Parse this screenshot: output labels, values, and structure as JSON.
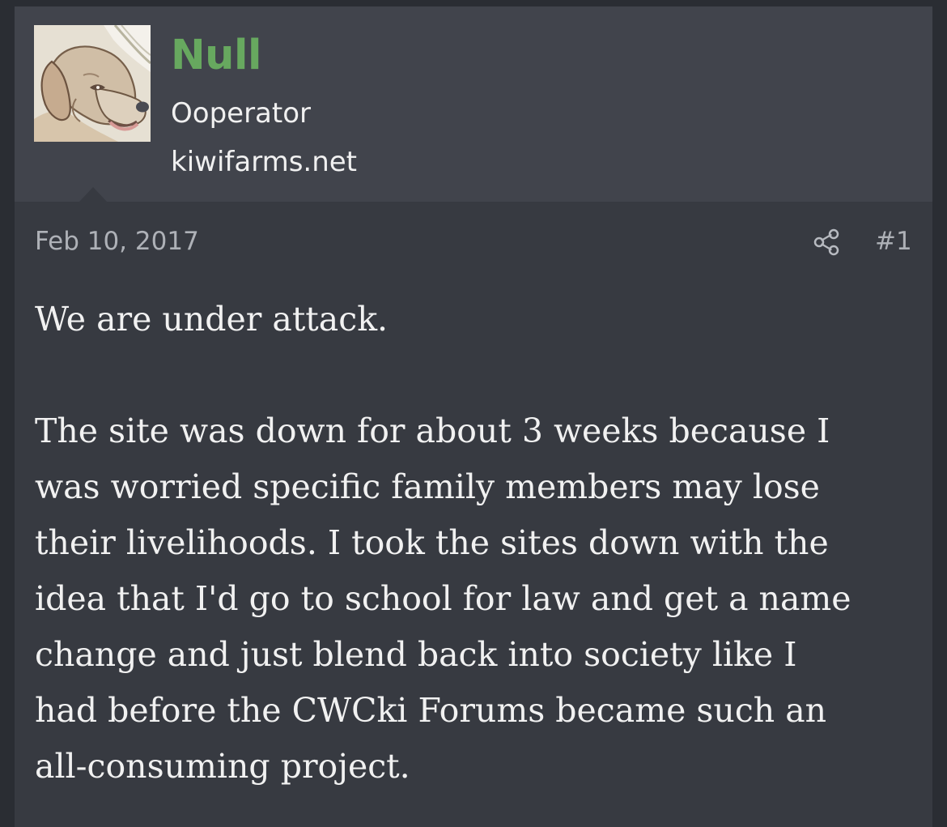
{
  "user": {
    "name": "Null",
    "title": "Ooperator",
    "site": "kiwifarms.net",
    "avatar_icon": "dog-avatar-icon",
    "name_color": "#67a85f"
  },
  "post": {
    "date": "Feb 10, 2017",
    "number": "#1",
    "share_icon": "share-icon",
    "paragraphs": [
      "We are under attack.",
      "The site was down for about 3 weeks because I\nwas worried specific family members may lose\ntheir livelihoods. I took the sites down with the\nidea that I'd go to school for law and get a name\nchange and just blend back into society like I\nhad before the CWCki Forums became such an\nall-consuming project."
    ]
  },
  "colors": {
    "page_background": "#2a2d33",
    "post_background": "#373a41",
    "user_block_background": "#41444c",
    "meta_text": "#aeb1b7",
    "body_text": "#f1f1f1"
  }
}
